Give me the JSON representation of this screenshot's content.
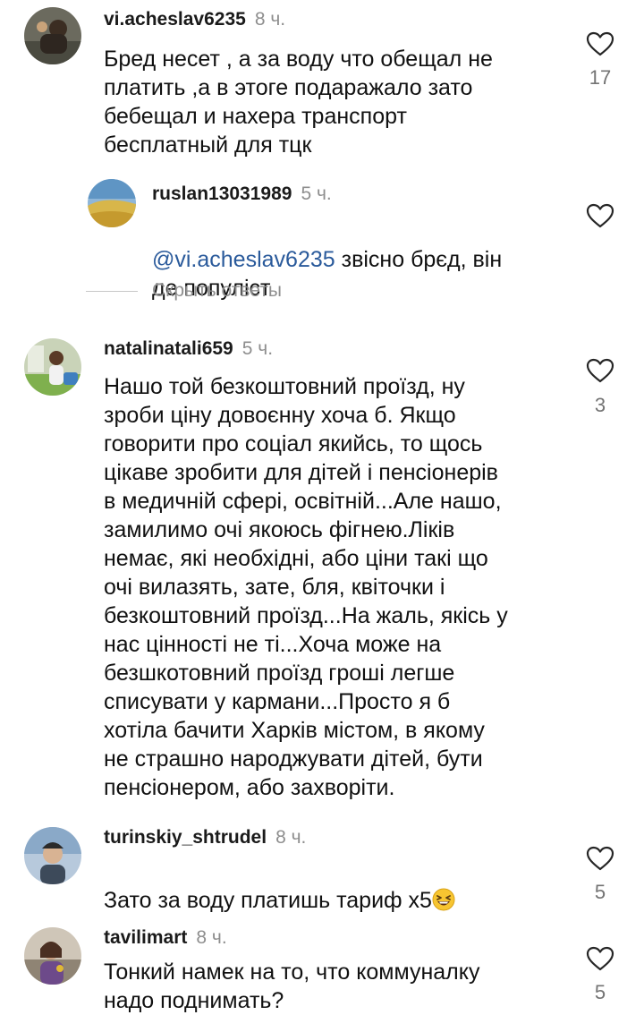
{
  "comments": [
    {
      "username": "vi.acheslav6235",
      "time": "8 ч.",
      "text": "Бред несет , а за воду что обещал не\nплатить ,а в этоге подаражало  зато\nбебещал и нахера транспорт\nбесплатный для тцк",
      "likes": "17"
    },
    {
      "username": "natalinatali659",
      "time": "5 ч.",
      "text": "Нашо той безкоштовний проїзд, ну\nзроби ціну довоєнну хоча б. Якщо\nговорити про соціал якийсь, то щось\nцікаве зробити для дітей і пенсіонерів\nв медичній сфері, освітній...Але нашо,\nзамилимо очі якоюсь фігнею.Ліків\nнемає, які необхідні, або ціни такі що\nочі вилазять,  зате, бля, квіточки і\nбезкоштовний проїзд...На жаль, якісь у\nнас цінності не ті...Хоча може на\nбезшкотовний проїзд гроші легше\nсписувати у кармани...Просто я  б\nхотіла бачити Харків містом, в якому\nне страшно народжувати дітей, бути\nпенсіонером, або захворіти.",
      "likes": "3"
    },
    {
      "username": "turinskiy_shtrudel",
      "time": "8 ч.",
      "text": "Зато за воду платишь тариф х5",
      "likes": "5"
    },
    {
      "username": "tavilimart",
      "time": "8 ч.",
      "text": "Тонкий намек на то, что коммуналку\nнадо поднимать?",
      "likes": "5"
    }
  ],
  "reply": {
    "username": "ruslan13031989",
    "time": "5 ч.",
    "mention": "@vi.acheslav6235",
    "text_line1": " звісно  брєд,  він",
    "text_line2": "де популіст"
  },
  "hide_replies_label": "Скрыть ответы",
  "icons": {
    "like": "heart-outline-icon",
    "emoji": "grinning-squinting-face-emoji"
  },
  "colors": {
    "mention": "#2a5a9b",
    "secondary_text": "#8e8e8e"
  }
}
